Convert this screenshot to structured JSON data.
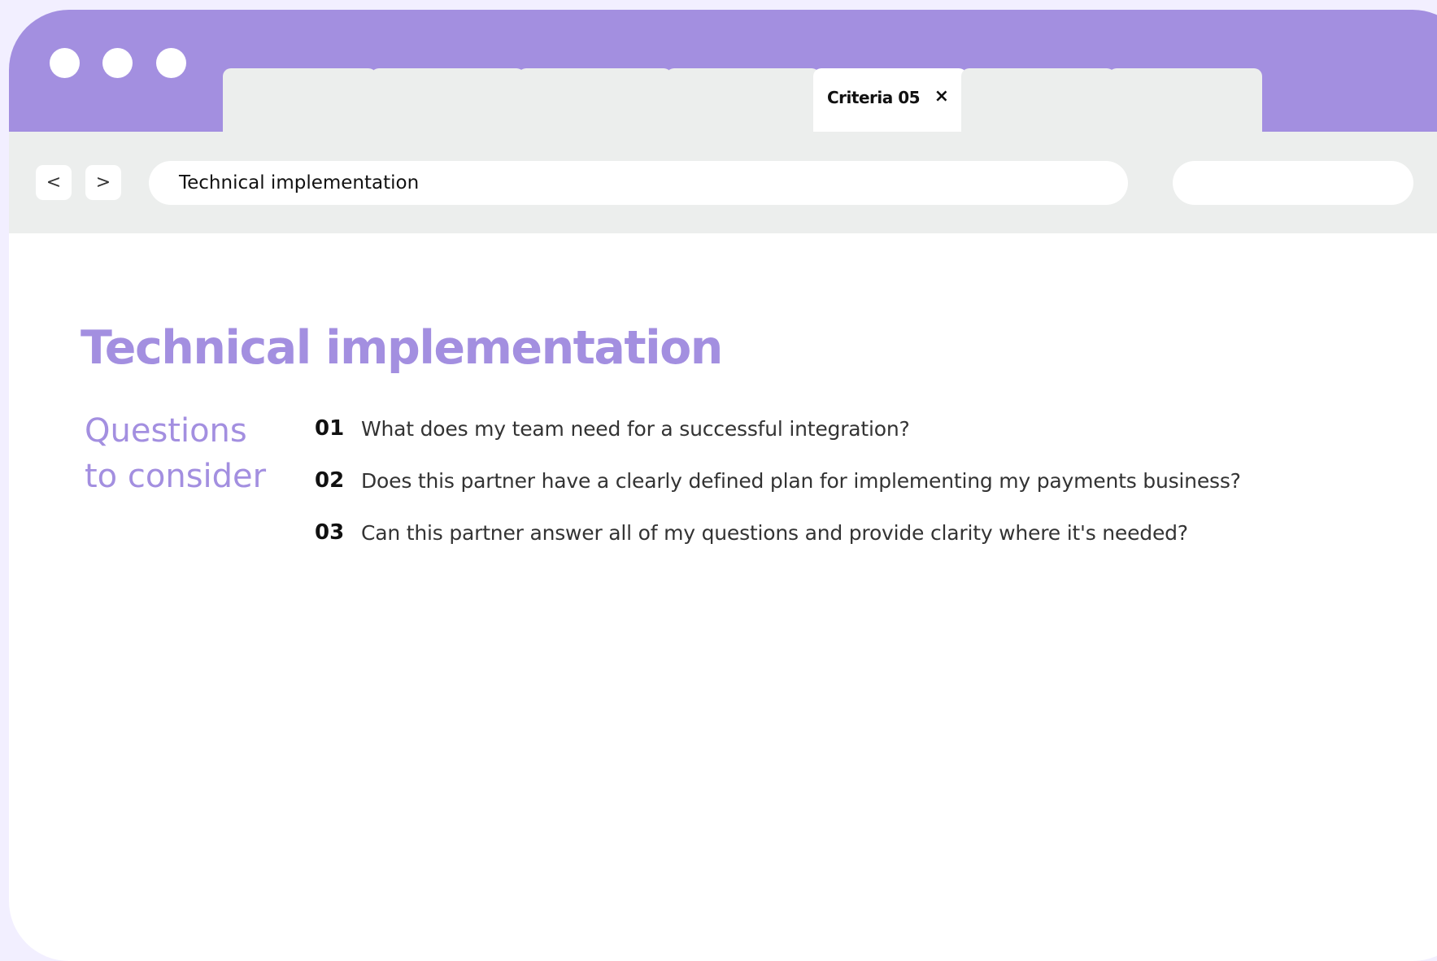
{
  "tabs": [
    {
      "label": "",
      "active": false
    },
    {
      "label": "",
      "active": false
    },
    {
      "label": "",
      "active": false
    },
    {
      "label": "",
      "active": false
    },
    {
      "label": "Criteria 05",
      "active": true
    },
    {
      "label": "",
      "active": false
    },
    {
      "label": "",
      "active": false
    }
  ],
  "tab_close_glyph": "×",
  "nav": {
    "back_label": "<",
    "forward_label": ">"
  },
  "address_bar": {
    "value": "Technical implementation"
  },
  "search": {
    "value": ""
  },
  "content": {
    "title": "Technical implementation",
    "side_heading_line1": "Questions",
    "side_heading_line2": "to consider",
    "questions": [
      {
        "number": "01",
        "text": "What does my team need for a successful integration?"
      },
      {
        "number": "02",
        "text": "Does this partner have a clearly defined plan for implementing my payments business?"
      },
      {
        "number": "03",
        "text": "Can this partner answer all of my questions and provide clarity where it's needed?"
      }
    ]
  },
  "colors": {
    "accent": "#a38fe0",
    "toolbar": "#eceeed",
    "page_background": "#f2efff"
  }
}
